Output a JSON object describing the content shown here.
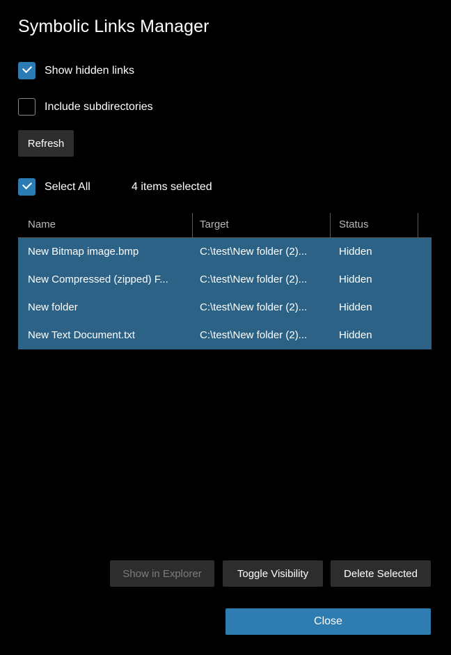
{
  "window": {
    "title": "Symbolic Links Manager",
    "background": "#000000",
    "accent": "#2b7cb5",
    "selection_color": "#2b6286"
  },
  "options": {
    "show_hidden": {
      "label": "Show hidden links",
      "checked": true
    },
    "include_subdirectories": {
      "label": "Include subdirectories",
      "checked": false
    },
    "refresh_label": "Refresh"
  },
  "selection": {
    "select_all_label": "Select All",
    "select_all_checked": true,
    "count_text": "4 items selected"
  },
  "table": {
    "columns": [
      "Name",
      "Target",
      "Status"
    ],
    "rows": [
      {
        "name": "New Bitmap image.bmp",
        "target": "C:\\test\\New folder (2)...",
        "status": "Hidden",
        "selected": true
      },
      {
        "name": "New Compressed (zipped) F...",
        "target": "C:\\test\\New folder (2)...",
        "status": "Hidden",
        "selected": true
      },
      {
        "name": "New folder",
        "target": "C:\\test\\New folder (2)...",
        "status": "Hidden",
        "selected": true
      },
      {
        "name": "New Text Document.txt",
        "target": "C:\\test\\New folder (2)...",
        "status": "Hidden",
        "selected": true
      }
    ]
  },
  "actions": {
    "show_in_explorer": {
      "label": "Show in Explorer",
      "disabled": true
    },
    "toggle_visibility": {
      "label": "Toggle Visibility",
      "disabled": false
    },
    "delete_selected": {
      "label": "Delete Selected",
      "disabled": false
    },
    "close": {
      "label": "Close",
      "disabled": false
    }
  }
}
